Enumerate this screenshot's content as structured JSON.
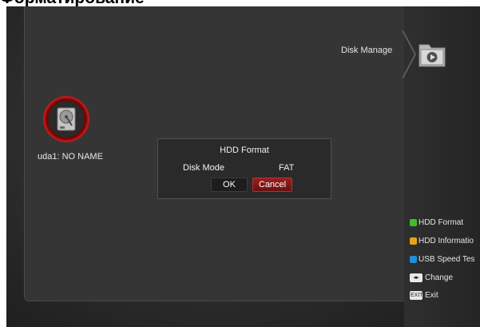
{
  "page_heading": "Форматирование",
  "header": {
    "disk_manage_label": "Disk Manage"
  },
  "disk": {
    "label": "uda1: NO NAME"
  },
  "dialog": {
    "title": "HDD Format",
    "mode_label": "Disk Mode",
    "mode_value": "FAT",
    "ok_label": "OK",
    "cancel_label": "Cancel"
  },
  "legend": [
    {
      "label": "HDD Format",
      "color": "#3cbf2a",
      "icon": "green-key-icon"
    },
    {
      "label": "HDD Informatio",
      "color": "#e8a21a",
      "icon": "yellow-key-icon"
    },
    {
      "label": "USB Speed Tes",
      "color": "#1e8fd8",
      "icon": "blue-key-icon"
    },
    {
      "label": "Change",
      "key_text": "◂▸",
      "icon": "left-right-key-icon"
    },
    {
      "label": "Exit",
      "key_text": "EXIT",
      "icon": "exit-key-icon"
    }
  ]
}
